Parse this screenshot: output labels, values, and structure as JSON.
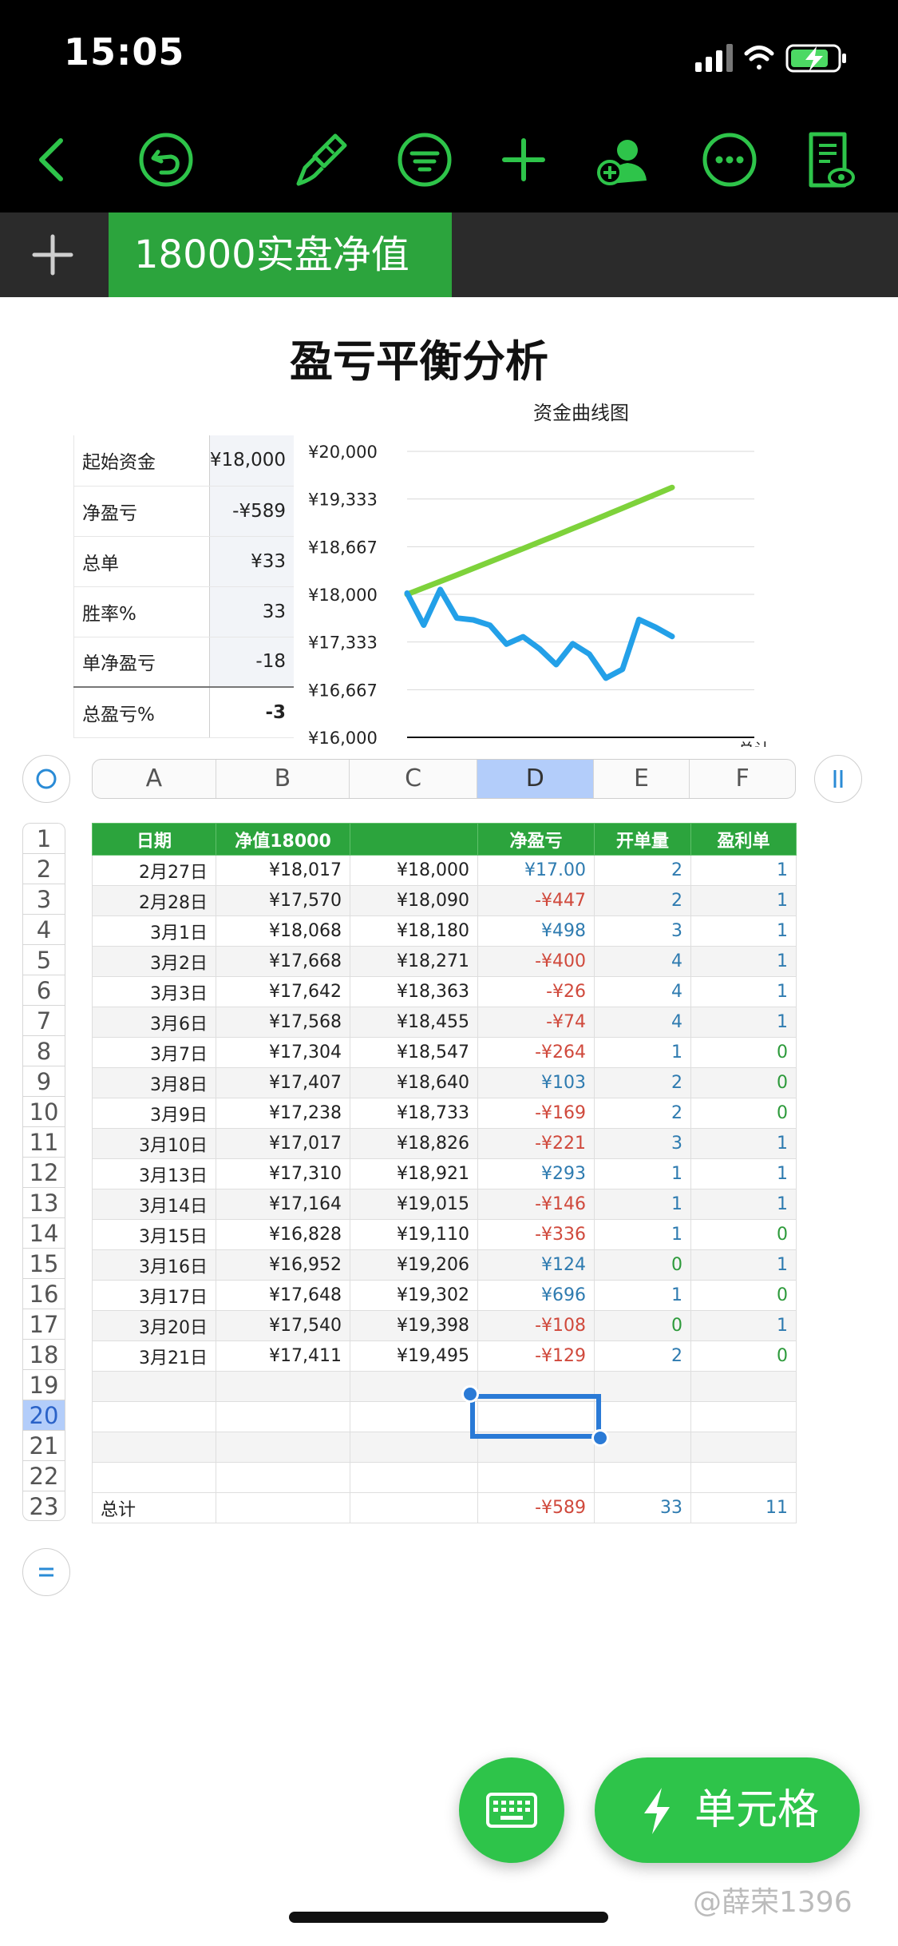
{
  "status_bar": {
    "time": "15:05"
  },
  "toolbar": {
    "icons": [
      "back-icon",
      "undo-icon",
      "paintbrush-icon",
      "format-icon",
      "add-icon",
      "collaborate-icon",
      "more-icon",
      "reader-view-icon"
    ],
    "accent": "#2ec44a"
  },
  "sheet_tabs": {
    "active": "18000实盘净值"
  },
  "title": "盈亏平衡分析",
  "summary": [
    {
      "label": "起始资金",
      "value": "¥18,000"
    },
    {
      "label": "净盈亏",
      "value": "-¥589"
    },
    {
      "label": "总单",
      "value": "¥33"
    },
    {
      "label": "胜率%",
      "value": "33"
    },
    {
      "label": "单净盈亏",
      "value": "-18"
    },
    {
      "label": "总盈亏%",
      "value": "-3"
    }
  ],
  "chart_data": {
    "type": "line",
    "title": "资金曲线图",
    "x_label_partial": "总计",
    "yticks": [
      "¥20,000",
      "¥19,333",
      "¥18,667",
      "¥18,000",
      "¥17,333",
      "¥16,667",
      "¥16,000"
    ],
    "ylim": [
      16000,
      20000
    ],
    "x": [
      "2月27日",
      "2月28日",
      "3月1日",
      "3月2日",
      "3月3日",
      "3月6日",
      "3月7日",
      "3月8日",
      "3月9日",
      "3月10日",
      "3月13日",
      "3月14日",
      "3月15日",
      "3月16日",
      "3月17日",
      "3月20日",
      "3月21日"
    ],
    "series": [
      {
        "color": "#7ed23b",
        "values": [
          18000,
          18090,
          18180,
          18271,
          18363,
          18455,
          18547,
          18640,
          18733,
          18826,
          18921,
          19015,
          19110,
          19206,
          19302,
          19398,
          19495
        ]
      },
      {
        "color": "#23a0e8",
        "values": [
          18017,
          17570,
          18068,
          17668,
          17642,
          17568,
          17304,
          17407,
          17238,
          17017,
          17310,
          17164,
          16828,
          16952,
          17648,
          17540,
          17411
        ]
      }
    ]
  },
  "columns": [
    "A",
    "B",
    "C",
    "D",
    "E",
    "F"
  ],
  "selected_column": "D",
  "header_row": [
    "日期",
    "净值18000",
    "",
    "净盈亏",
    "开单量",
    "盈利单"
  ],
  "rows": [
    [
      "2月27日",
      "¥18,017",
      "¥18,000",
      "¥17.00",
      "2",
      "1"
    ],
    [
      "2月28日",
      "¥17,570",
      "¥18,090",
      "-¥447",
      "2",
      "1"
    ],
    [
      "3月1日",
      "¥18,068",
      "¥18,180",
      "¥498",
      "3",
      "1"
    ],
    [
      "3月2日",
      "¥17,668",
      "¥18,271",
      "-¥400",
      "4",
      "1"
    ],
    [
      "3月3日",
      "¥17,642",
      "¥18,363",
      "-¥26",
      "4",
      "1"
    ],
    [
      "3月6日",
      "¥17,568",
      "¥18,455",
      "-¥74",
      "4",
      "1"
    ],
    [
      "3月7日",
      "¥17,304",
      "¥18,547",
      "-¥264",
      "1",
      "0"
    ],
    [
      "3月8日",
      "¥17,407",
      "¥18,640",
      "¥103",
      "2",
      "0"
    ],
    [
      "3月9日",
      "¥17,238",
      "¥18,733",
      "-¥169",
      "2",
      "0"
    ],
    [
      "3月10日",
      "¥17,017",
      "¥18,826",
      "-¥221",
      "3",
      "1"
    ],
    [
      "3月13日",
      "¥17,310",
      "¥18,921",
      "¥293",
      "1",
      "1"
    ],
    [
      "3月14日",
      "¥17,164",
      "¥19,015",
      "-¥146",
      "1",
      "1"
    ],
    [
      "3月15日",
      "¥16,828",
      "¥19,110",
      "-¥336",
      "1",
      "0"
    ],
    [
      "3月16日",
      "¥16,952",
      "¥19,206",
      "¥124",
      "0",
      "1"
    ],
    [
      "3月17日",
      "¥17,648",
      "¥19,302",
      "¥696",
      "1",
      "0"
    ],
    [
      "3月20日",
      "¥17,540",
      "¥19,398",
      "-¥108",
      "0",
      "1"
    ],
    [
      "3月21日",
      "¥17,411",
      "¥19,495",
      "-¥129",
      "2",
      "0"
    ]
  ],
  "total_row": [
    "总计",
    "",
    "",
    "-¥589",
    "33",
    "11"
  ],
  "selected_row": "20",
  "fab": {
    "cell_label": "单元格"
  },
  "watermark": "@薛荣1396",
  "colors": {
    "header_green": "#2ca43d",
    "negative": "#d0493c",
    "positive": "#2e7bb0",
    "green_value": "#2d9a3b",
    "selection_blue": "#2a7ad6"
  }
}
